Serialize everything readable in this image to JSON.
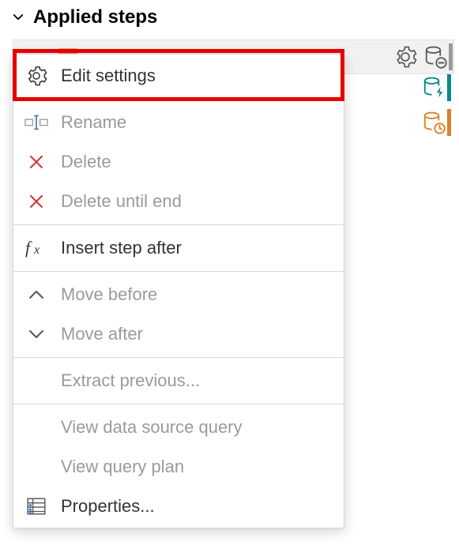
{
  "header": {
    "title": "Applied steps"
  },
  "menu": {
    "edit_settings": "Edit settings",
    "rename": "Rename",
    "delete": "Delete",
    "delete_until_end": "Delete until end",
    "insert_step_after": "Insert step after",
    "move_before": "Move before",
    "move_after": "Move after",
    "extract_previous": "Extract previous...",
    "view_data_source_query": "View data source query",
    "view_query_plan": "View query plan",
    "properties": "Properties..."
  }
}
